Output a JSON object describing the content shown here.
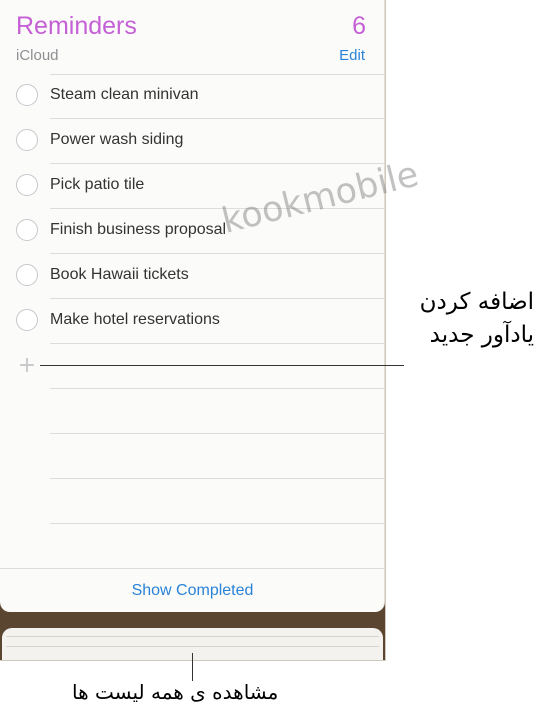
{
  "header": {
    "title": "Reminders",
    "count": "6",
    "account": "iCloud",
    "edit_label": "Edit"
  },
  "reminders": [
    {
      "label": "Steam clean minivan"
    },
    {
      "label": "Power wash siding"
    },
    {
      "label": "Pick patio tile"
    },
    {
      "label": "Finish business proposal"
    },
    {
      "label": "Book Hawaii tickets"
    },
    {
      "label": "Make hotel reservations"
    }
  ],
  "add_icon": "plus-icon",
  "footer": {
    "show_completed_label": "Show Completed"
  },
  "watermark": "kookmobile",
  "annotations": {
    "add_new_line1": "اضافه کردن",
    "add_new_line2": "یادآور جدید",
    "view_all_lists": "مشاهده ی همه لیست ها"
  },
  "colors": {
    "accent": "#c660d6",
    "link": "#2a83d8",
    "background_stack": "#5a4530"
  }
}
